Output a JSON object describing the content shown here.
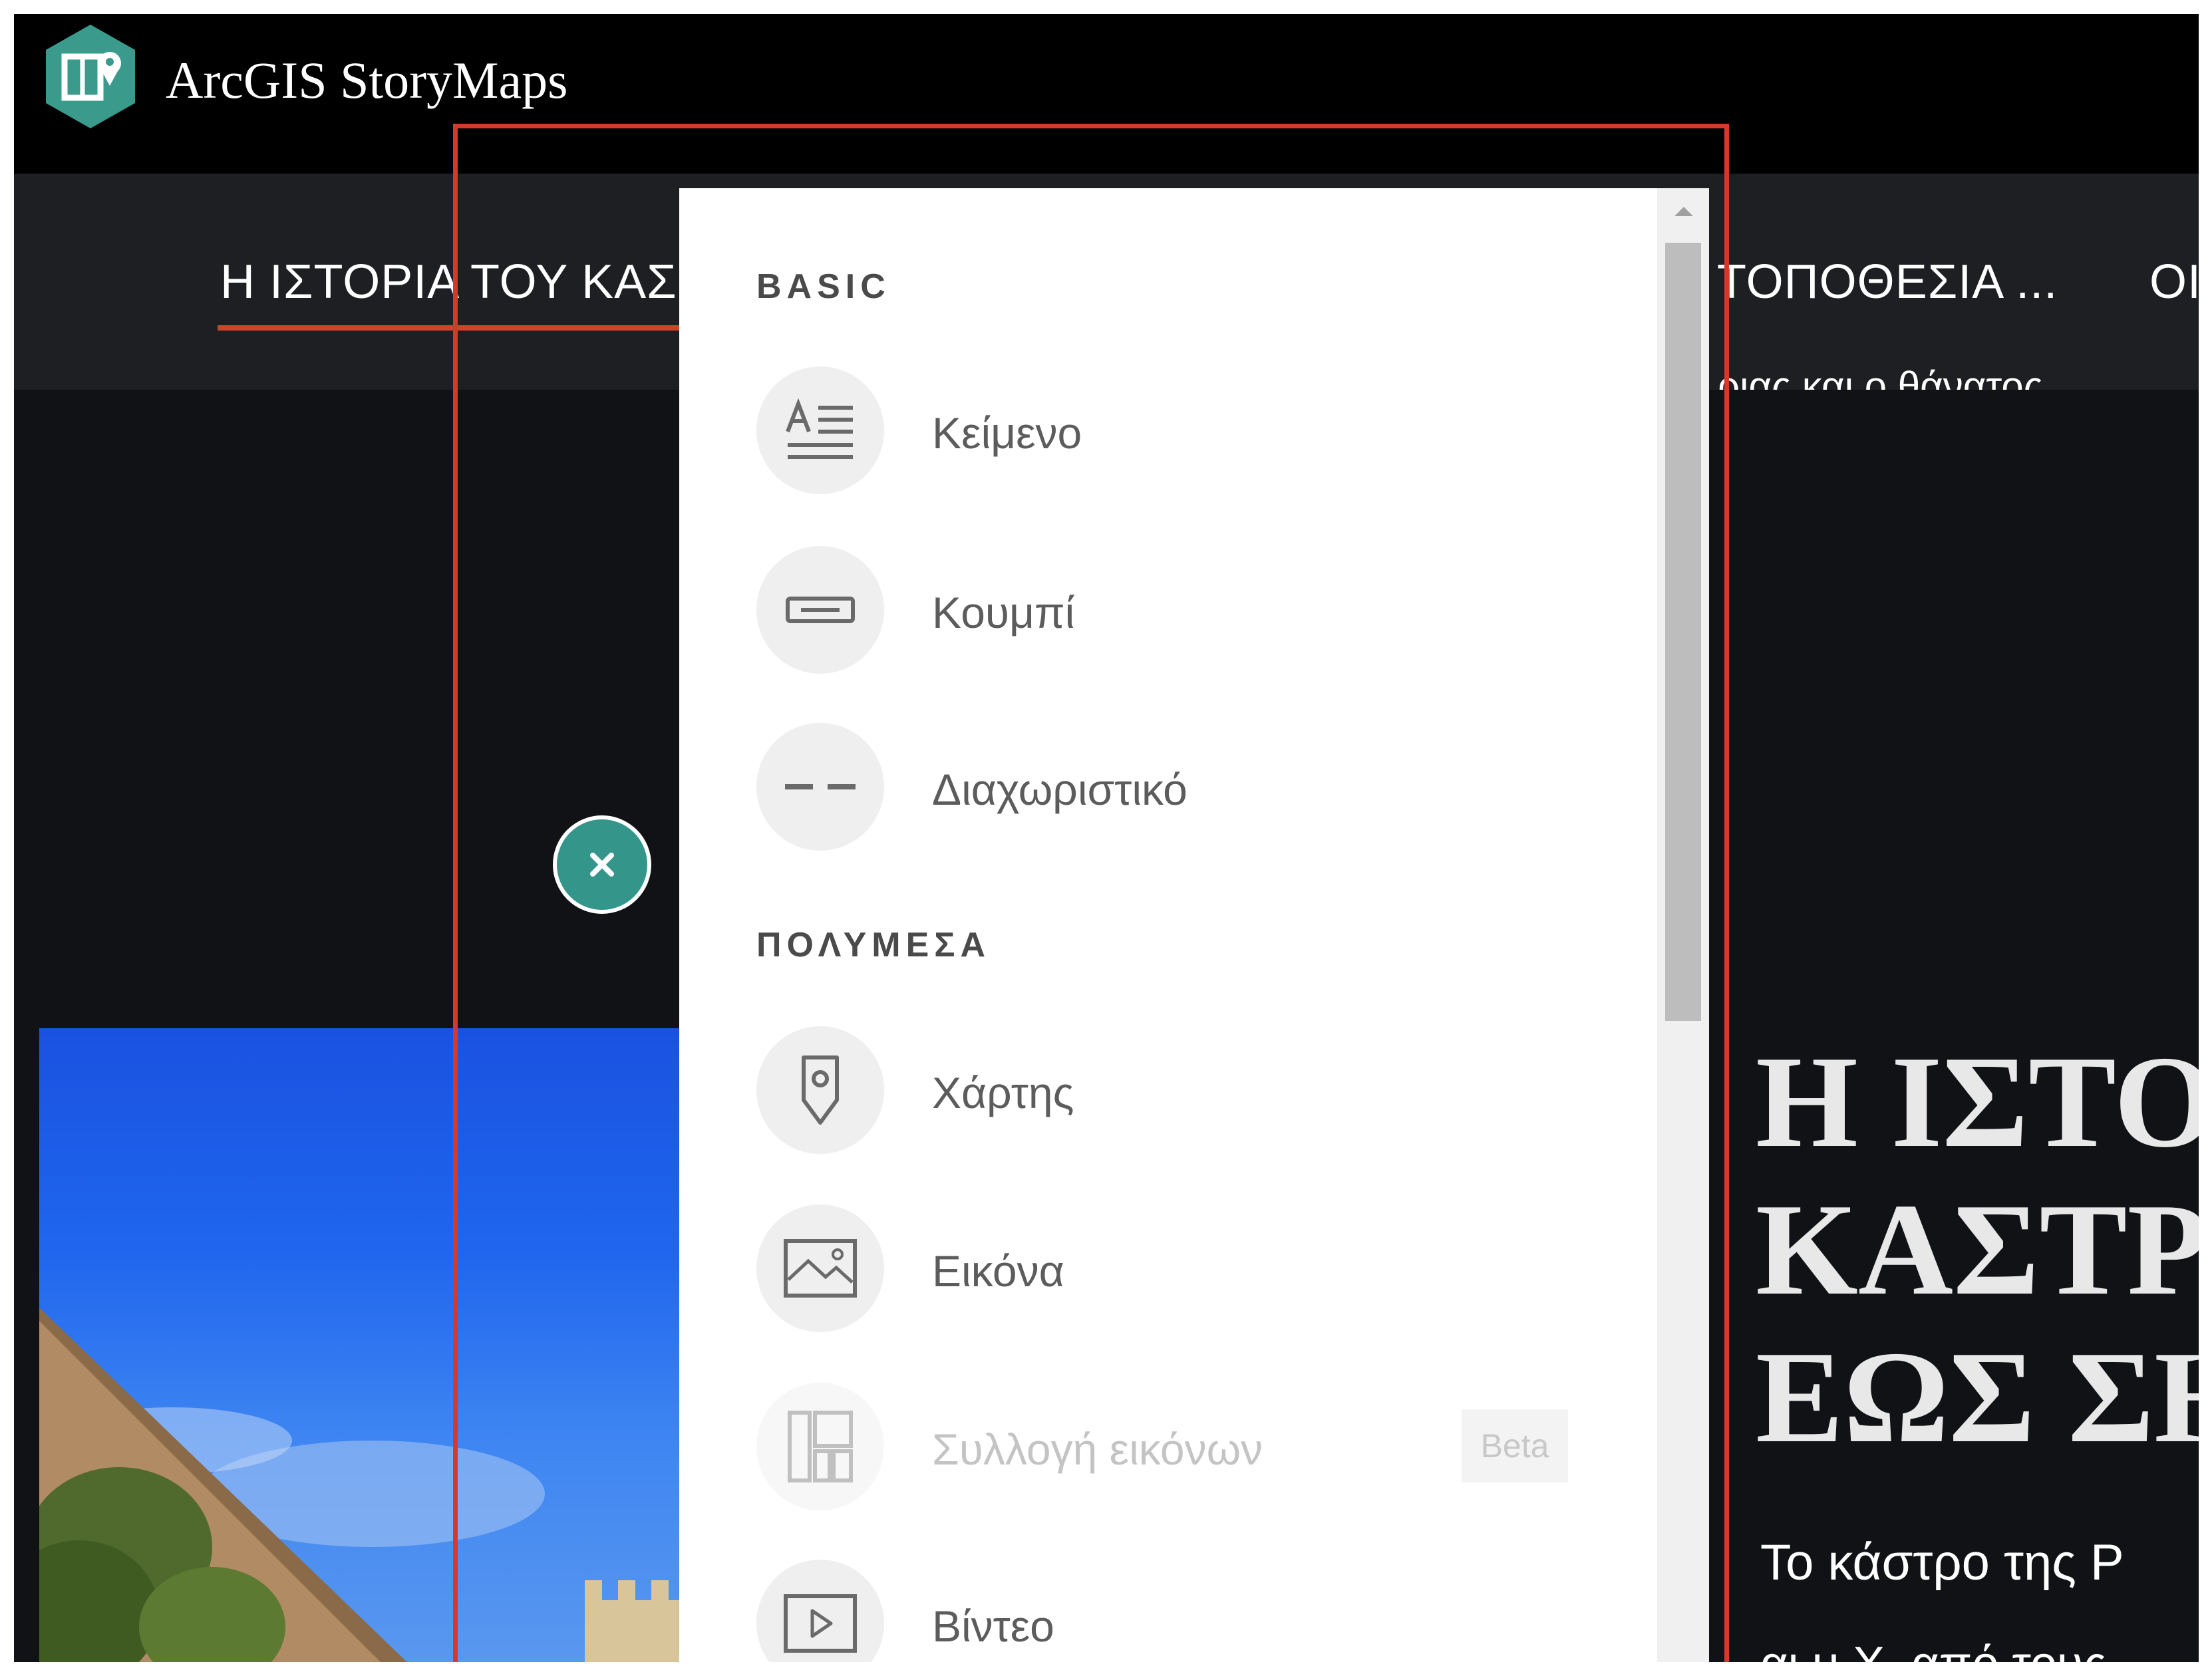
{
  "app": {
    "title": "ArcGIS StoryMaps",
    "logo_icon": "storymaps-logo-icon",
    "brand_color": "#3a9a8c"
  },
  "nav": {
    "tabs": [
      {
        "label": "Η ΙΣΤΟΡΙΑ ΤΟΥ ΚΑΣ",
        "active": true
      },
      {
        "label": "ΤΟΠΟΘΕΣΙΑ ..."
      },
      {
        "label": "ΟΙ"
      }
    ],
    "accent_color": "#d1422d",
    "partial_text": "ριας και ο θάνατος"
  },
  "content": {
    "heading_lines": [
      "Η ΙΣΤΟ",
      "ΚΑΣΤΡΟ",
      "ΕΩΣ ΣΗ"
    ],
    "paragraph": "Το κάστρο της Ρ",
    "paragraph_line2": "αι μ.Χ. από τους"
  },
  "close_button": {
    "icon": "close-icon",
    "color": "#34968a"
  },
  "panel": {
    "sections": [
      {
        "title": "BASIC",
        "items": [
          {
            "label": "Κείμενο",
            "icon": "text-icon"
          },
          {
            "label": "Κουμπί",
            "icon": "button-icon"
          },
          {
            "label": "Διαχωριστικό",
            "icon": "separator-icon"
          }
        ]
      },
      {
        "title": "ΠΟΛΥΜΕΣΑ",
        "items": [
          {
            "label": "Χάρτης",
            "icon": "map-icon"
          },
          {
            "label": "Εικόνα",
            "icon": "image-icon"
          },
          {
            "label": "Συλλογή εικόνων",
            "icon": "gallery-icon",
            "disabled": true,
            "badge": "Beta"
          },
          {
            "label": "Βίντεο",
            "icon": "video-icon"
          }
        ]
      }
    ]
  },
  "annotation": {
    "color": "#d33a2c"
  }
}
